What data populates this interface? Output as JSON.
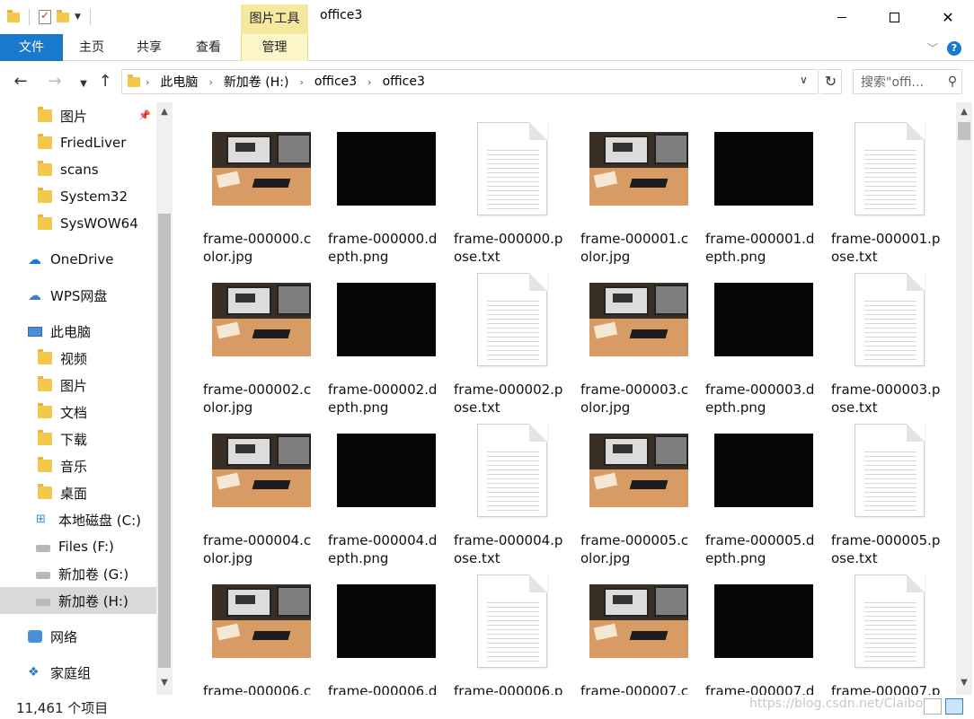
{
  "window": {
    "title": "office3",
    "context_tab_header": "图片工具"
  },
  "ribbon": {
    "tabs": [
      {
        "label": "文件"
      },
      {
        "label": "主页"
      },
      {
        "label": "共享"
      },
      {
        "label": "查看"
      },
      {
        "label": "管理"
      }
    ]
  },
  "address": {
    "crumbs": [
      "此电脑",
      "新加卷 (H:)",
      "office3",
      "office3"
    ],
    "search_placeholder": "搜索\"offi..."
  },
  "nav": {
    "items": [
      {
        "label": "图片",
        "icon": "folder-icon",
        "pinned": true
      },
      {
        "label": "FriedLiver",
        "icon": "folder-icon"
      },
      {
        "label": "scans",
        "icon": "folder-icon"
      },
      {
        "label": "System32",
        "icon": "folder-icon"
      },
      {
        "label": "SysWOW64",
        "icon": "folder-icon"
      },
      {
        "label": "OneDrive",
        "icon": "onedrive-icon"
      },
      {
        "label": "WPS网盘",
        "icon": "cloud-icon"
      },
      {
        "label": "此电脑",
        "icon": "computer-icon"
      },
      {
        "label": "视频",
        "icon": "videos-folder-icon"
      },
      {
        "label": "图片",
        "icon": "pictures-folder-icon"
      },
      {
        "label": "文档",
        "icon": "documents-folder-icon"
      },
      {
        "label": "下载",
        "icon": "downloads-folder-icon"
      },
      {
        "label": "音乐",
        "icon": "music-folder-icon"
      },
      {
        "label": "桌面",
        "icon": "desktop-folder-icon"
      },
      {
        "label": "本地磁盘 (C:)",
        "icon": "windows-drive-icon"
      },
      {
        "label": "Files (F:)",
        "icon": "drive-icon"
      },
      {
        "label": "新加卷 (G:)",
        "icon": "drive-icon"
      },
      {
        "label": "新加卷 (H:)",
        "icon": "drive-icon",
        "selected": true
      },
      {
        "label": "网络",
        "icon": "network-icon"
      },
      {
        "label": "家庭组",
        "icon": "homegroup-icon"
      }
    ]
  },
  "files": [
    {
      "name": "frame-000000.color.jpg",
      "kind": "photo"
    },
    {
      "name": "frame-000000.depth.png",
      "kind": "depth"
    },
    {
      "name": "frame-000000.pose.txt",
      "kind": "text"
    },
    {
      "name": "frame-000001.color.jpg",
      "kind": "photo"
    },
    {
      "name": "frame-000001.depth.png",
      "kind": "depth"
    },
    {
      "name": "frame-000001.pose.txt",
      "kind": "text"
    },
    {
      "name": "frame-000002.color.jpg",
      "kind": "photo"
    },
    {
      "name": "frame-000002.depth.png",
      "kind": "depth"
    },
    {
      "name": "frame-000002.pose.txt",
      "kind": "text"
    },
    {
      "name": "frame-000003.color.jpg",
      "kind": "photo"
    },
    {
      "name": "frame-000003.depth.png",
      "kind": "depth"
    },
    {
      "name": "frame-000003.pose.txt",
      "kind": "text"
    },
    {
      "name": "frame-000004.color.jpg",
      "kind": "photo"
    },
    {
      "name": "frame-000004.depth.png",
      "kind": "depth"
    },
    {
      "name": "frame-000004.pose.txt",
      "kind": "text"
    },
    {
      "name": "frame-000005.color.jpg",
      "kind": "photo"
    },
    {
      "name": "frame-000005.depth.png",
      "kind": "depth"
    },
    {
      "name": "frame-000005.pose.txt",
      "kind": "text"
    },
    {
      "name": "frame-000006.c",
      "kind": "photo"
    },
    {
      "name": "frame-000006.d",
      "kind": "depth"
    },
    {
      "name": "frame-000006.p",
      "kind": "text"
    },
    {
      "name": "frame-000007.c",
      "kind": "photo"
    },
    {
      "name": "frame-000007.d",
      "kind": "depth"
    },
    {
      "name": "frame-000007.p",
      "kind": "text"
    }
  ],
  "status": {
    "item_count": "11,461 个项目",
    "watermark": "https://blog.csdn.net/Claibo"
  }
}
